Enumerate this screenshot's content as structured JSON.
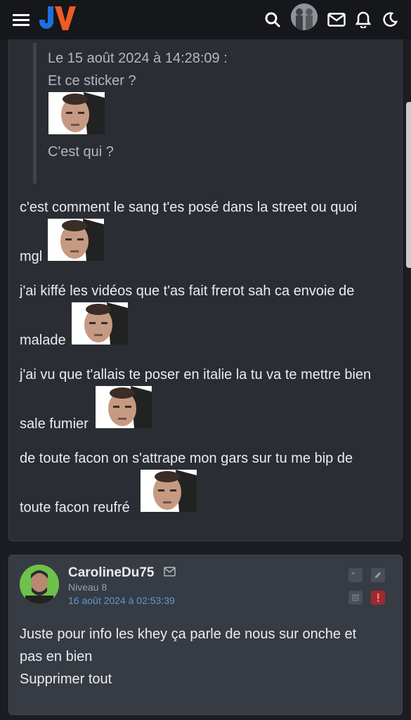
{
  "header": {
    "logo_text": "JV",
    "icons": [
      "menu-icon",
      "search-icon",
      "user-avatar",
      "mail-icon",
      "bell-icon",
      "moon-icon"
    ]
  },
  "colors": {
    "logo_blue": "#1f6fe0",
    "logo_orange": "#f05a24",
    "link": "#5b9bd5",
    "alert": "#9b2b2f"
  },
  "post1": {
    "quote": {
      "header": "Le 15 août 2024 à 14:28:09 :",
      "line1": "Et ce sticker ?",
      "line2": "C'est qui ?"
    },
    "lines": [
      "c'est comment le sang t'es posé dans la street ou quoi",
      "mgl",
      "j'ai kiffé les vidéos que t'as fait frerot sah ca envoie de",
      "malade",
      "j'ai vu que t'allais te poser en italie la tu va te mettre bien",
      "sale fumier",
      "de toute facon on s'attrape mon gars sur tu me bip de",
      "toute facon reufré"
    ]
  },
  "post2": {
    "username": "CarolineDu75",
    "level": "Niveau 8",
    "date": "16 août 2024 à 02:53:39",
    "text_line1": "Juste pour info les khey ça parle de nous sur onche et",
    "text_line2": "pas en bien",
    "text_line3": "Supprimer tout"
  }
}
